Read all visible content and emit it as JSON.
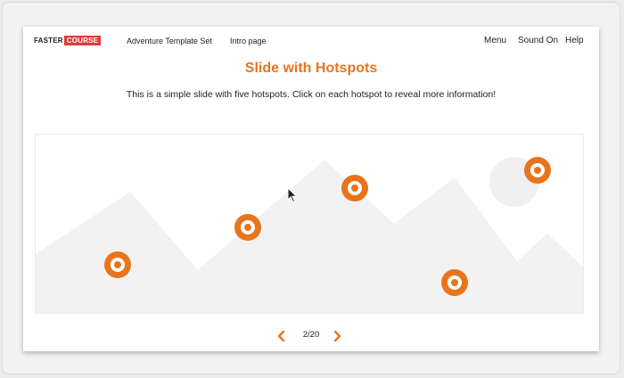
{
  "header": {
    "logo_part1": "FASTER",
    "logo_part2": "COURSE",
    "nav_links": [
      {
        "label": "Adventure Template Set"
      },
      {
        "label": "Intro page"
      }
    ],
    "right_links": [
      {
        "label": "Menu"
      },
      {
        "label": "Sound On"
      },
      {
        "label": "Help"
      }
    ]
  },
  "slide": {
    "title": "Slide with Hotspots",
    "subtitle": "This is a simple slide with five hotspots. Click on each hotspot to reveal more information!"
  },
  "pager": {
    "page": "2/20",
    "prev_icon": "chevron-left-icon",
    "next_icon": "chevron-right-icon"
  },
  "colors": {
    "accent": "#e8741c",
    "logo_red": "#e03a3a",
    "scenery": "#f2f2f2"
  }
}
